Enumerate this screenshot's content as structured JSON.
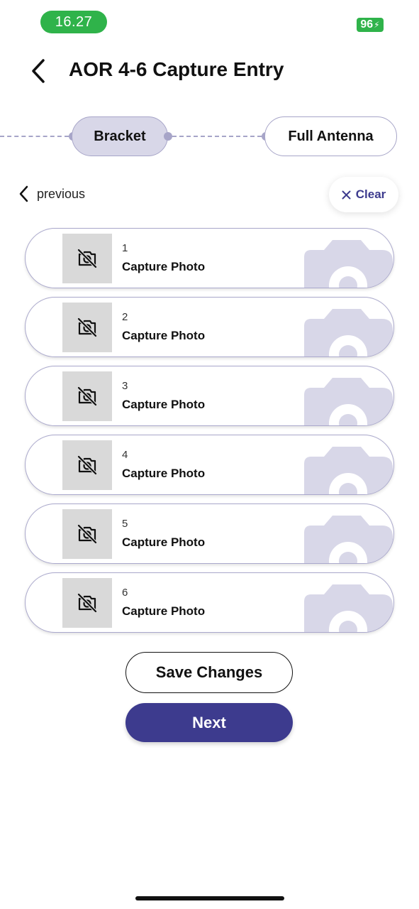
{
  "status_bar": {
    "time": "16.27",
    "battery": "96",
    "time_pill_color": "#2fb34a"
  },
  "header": {
    "title": "AOR 4-6 Capture Entry",
    "back_icon": "chevron-left-icon"
  },
  "stepper": {
    "steps": [
      {
        "label": "Bracket",
        "state": "active"
      },
      {
        "label": "Full Antenna",
        "state": "upcoming"
      }
    ]
  },
  "nav": {
    "previous_label": "previous",
    "clear_label": "Clear",
    "clear_icon": "close-icon"
  },
  "captures": [
    {
      "number": "1",
      "label": "Capture Photo"
    },
    {
      "number": "2",
      "label": "Capture Photo"
    },
    {
      "number": "3",
      "label": "Capture Photo"
    },
    {
      "number": "4",
      "label": "Capture Photo"
    },
    {
      "number": "5",
      "label": "Capture Photo"
    },
    {
      "number": "6",
      "label": "Capture Photo"
    }
  ],
  "actions": {
    "save_label": "Save Changes",
    "next_label": "Next"
  },
  "colors": {
    "primary": "#3d3b8e",
    "accent_light": "#d8d7e8",
    "border": "#aaa8cc",
    "status_green": "#2fb34a"
  }
}
